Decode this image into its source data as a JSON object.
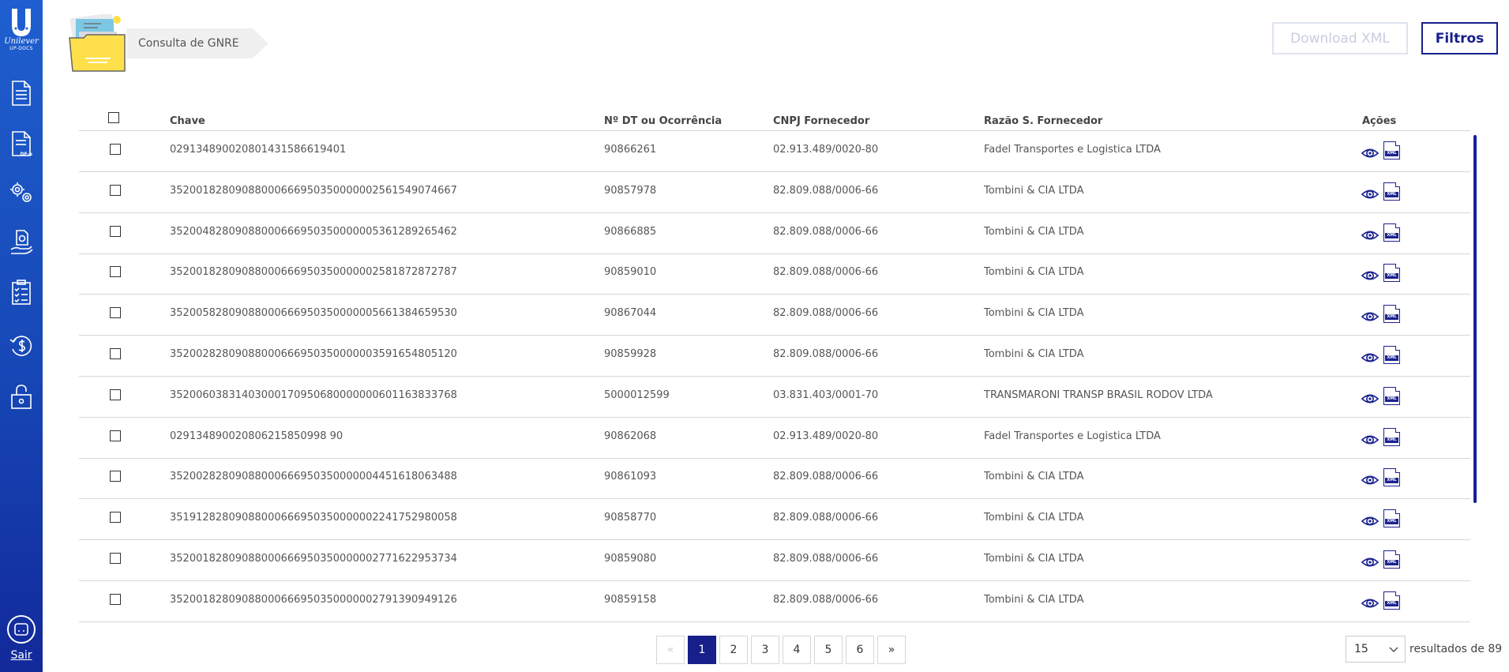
{
  "logo": {
    "brand": "Unilever",
    "sub": "UP-DOCS"
  },
  "sidebar": {
    "items": [
      {
        "name": "document-icon"
      },
      {
        "name": "dfe-document-icon",
        "tag": "DF-e"
      },
      {
        "name": "settings-gears-icon"
      },
      {
        "name": "money-hand-icon"
      },
      {
        "name": "checklist-icon"
      },
      {
        "name": "refund-icon"
      },
      {
        "name": "lock-icon"
      }
    ],
    "logout_label": "Sair"
  },
  "header": {
    "title": "Consulta de GNRE",
    "download_label": "Download XML",
    "filter_label": "Filtros"
  },
  "table": {
    "columns": [
      "Chave",
      "Nº DT ou Ocorrência",
      "CNPJ Fornecedor",
      "Razão S. Fornecedor",
      "Ações"
    ],
    "rows": [
      [
        "029134890020801431586619401",
        "90866261",
        "02.913.489/0020-80",
        "Fadel Transportes e Logistica LTDA"
      ],
      [
        "35200182809088000666950350000002561549074667",
        "90857978",
        "82.809.088/0006-66",
        "Tombini & CIA LTDA"
      ],
      [
        "35200482809088000666950350000005361289265462",
        "90866885",
        "82.809.088/0006-66",
        "Tombini & CIA LTDA"
      ],
      [
        "35200182809088000666950350000002581872872787",
        "90859010",
        "82.809.088/0006-66",
        "Tombini & CIA LTDA"
      ],
      [
        "35200582809088000666950350000005661384659530",
        "90867044",
        "82.809.088/0006-66",
        "Tombini & CIA LTDA"
      ],
      [
        "35200282809088000666950350000003591654805120",
        "90859928",
        "82.809.088/0006-66",
        "Tombini & CIA LTDA"
      ],
      [
        "35200603831403000170950680000000601163833768",
        "5000012599",
        "03.831.403/0001-70",
        "TRANSMARONI TRANSP BRASIL RODOV LTDA"
      ],
      [
        "029134890020806215850998 90",
        "90862068",
        "02.913.489/0020-80",
        "Fadel Transportes e Logistica LTDA"
      ],
      [
        "35200282809088000666950350000004451618063488",
        "90861093",
        "82.809.088/0006-66",
        "Tombini & CIA LTDA"
      ],
      [
        "35191282809088000666950350000002241752980058",
        "90858770",
        "82.809.088/0006-66",
        "Tombini & CIA LTDA"
      ],
      [
        "35200182809088000666950350000002771622953734",
        "90859080",
        "82.809.088/0006-66",
        "Tombini & CIA LTDA"
      ],
      [
        "35200182809088000666950350000002791390949126",
        "90859158",
        "82.809.088/0006-66",
        "Tombini & CIA LTDA"
      ]
    ],
    "actions": {
      "view_icon": "eye-icon",
      "xml_icon": "xml-file-icon",
      "xml_text": "XML"
    }
  },
  "pagination": {
    "prev": "«",
    "pages": [
      "1",
      "2",
      "3",
      "4",
      "5",
      "6"
    ],
    "active": "1",
    "next": "»",
    "page_size": "15",
    "results_text": "resultados de 89"
  }
}
